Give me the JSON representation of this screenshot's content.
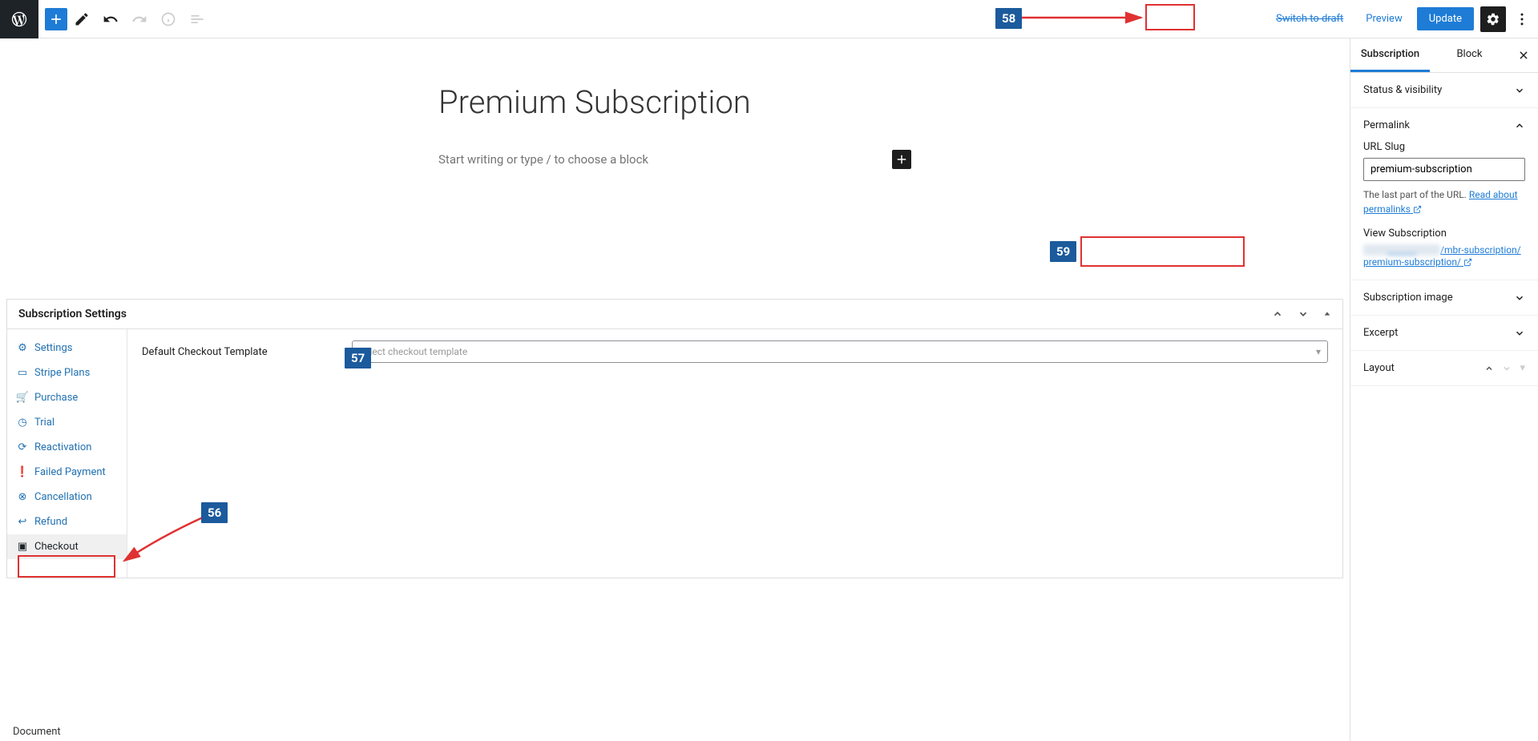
{
  "topbar": {
    "switch_draft": "Switch to draft",
    "preview": "Preview",
    "update": "Update"
  },
  "editor": {
    "title": "Premium Subscription",
    "prompt": "Start writing or type / to choose a block"
  },
  "metabox": {
    "title": "Subscription Settings",
    "nav": [
      {
        "icon": "gear",
        "label": "Settings"
      },
      {
        "icon": "stripe",
        "label": "Stripe Plans"
      },
      {
        "icon": "cart",
        "label": "Purchase"
      },
      {
        "icon": "clock",
        "label": "Trial"
      },
      {
        "icon": "refresh",
        "label": "Reactivation"
      },
      {
        "icon": "alert",
        "label": "Failed Payment"
      },
      {
        "icon": "close-circle",
        "label": "Cancellation"
      },
      {
        "icon": "return",
        "label": "Refund"
      },
      {
        "icon": "book",
        "label": "Checkout"
      }
    ],
    "form_label": "Default Checkout Template",
    "select_placeholder": "Select checkout template"
  },
  "sidebar": {
    "tabs": {
      "subscription": "Subscription",
      "block": "Block"
    },
    "panels": {
      "status": "Status & visibility",
      "permalink": "Permalink",
      "url_slug_label": "URL Slug",
      "url_slug_value": "premium-subscription",
      "helper_prefix": "The last part of the URL. ",
      "helper_link": "Read about permalinks",
      "view_label": "View Subscription",
      "permalink_url": "/mbr-subscription/premium-subscription/",
      "image": "Subscription image",
      "excerpt": "Excerpt",
      "layout": "Layout"
    }
  },
  "footer": {
    "document": "Document"
  },
  "annotations": {
    "b56": "56",
    "b57": "57",
    "b58": "58",
    "b59": "59"
  }
}
